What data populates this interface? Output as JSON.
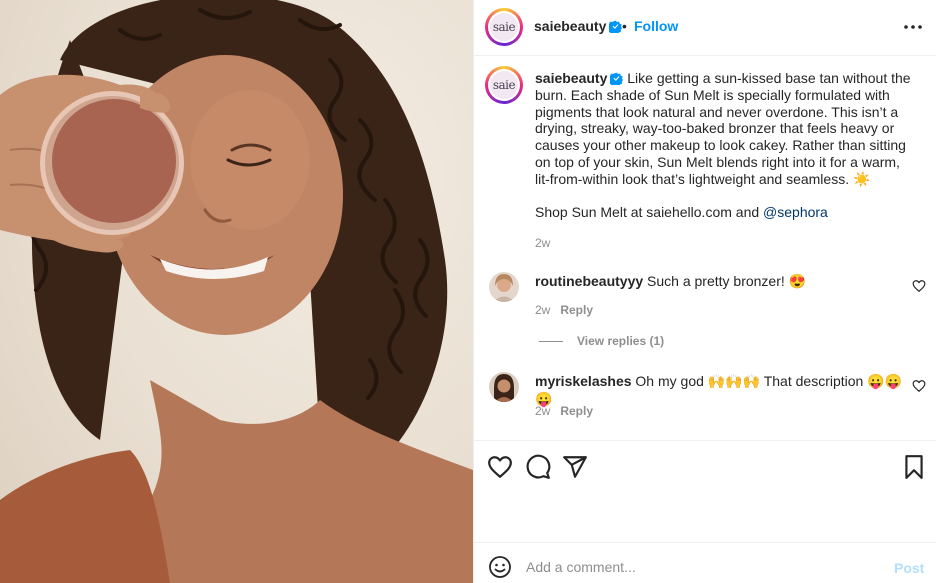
{
  "post": {
    "photo_alt": "Smiling woman holding a round bronzer compact over one eye",
    "brand_logo_text": "saie"
  },
  "header": {
    "username": "saiebeauty",
    "separator": "•",
    "follow_label": "Follow",
    "verified_icon": "verified-badge-icon",
    "more_icon": "more-options-icon"
  },
  "caption": {
    "username": "saiebeauty",
    "text": "Like getting a sun-kissed base tan without the burn. Each shade of Sun Melt is specially formulated with pigments that look natural and never overdone. This isn’t a drying, streaky, way-too-baked bronzer that feels heavy or causes your other makeup to look cakey. Rather than sitting on top of your skin, Sun Melt blends right into it for a warm, lit-from-within look that’s lightweight and seamless. ☀️",
    "shop_text": "Shop Sun Melt at saiehello.com and ",
    "mention": "@sephora",
    "time": "2w"
  },
  "comments": [
    {
      "username": "routinebeautyyy",
      "text": "Such a pretty bronzer! 😍",
      "time": "2w",
      "reply_label": "Reply"
    },
    {
      "username": "myriskelashes",
      "text": "Oh my god 🙌🙌🙌 That description 😛😛😛",
      "time": "2w",
      "reply_label": "Reply"
    }
  ],
  "view_replies_label": "View replies (1)",
  "actions": {
    "like_icon": "heart-icon",
    "comment_icon": "comment-icon",
    "share_icon": "share-icon",
    "save_icon": "bookmark-icon"
  },
  "add_comment": {
    "placeholder": "Add a comment...",
    "post_label": "Post",
    "emoji_icon": "emoji-icon"
  },
  "colors": {
    "accent": "#0095f6",
    "post_disabled": "#b2dffc",
    "muted": "#8e8e8e",
    "text": "#262626",
    "mention": "#00376b"
  }
}
